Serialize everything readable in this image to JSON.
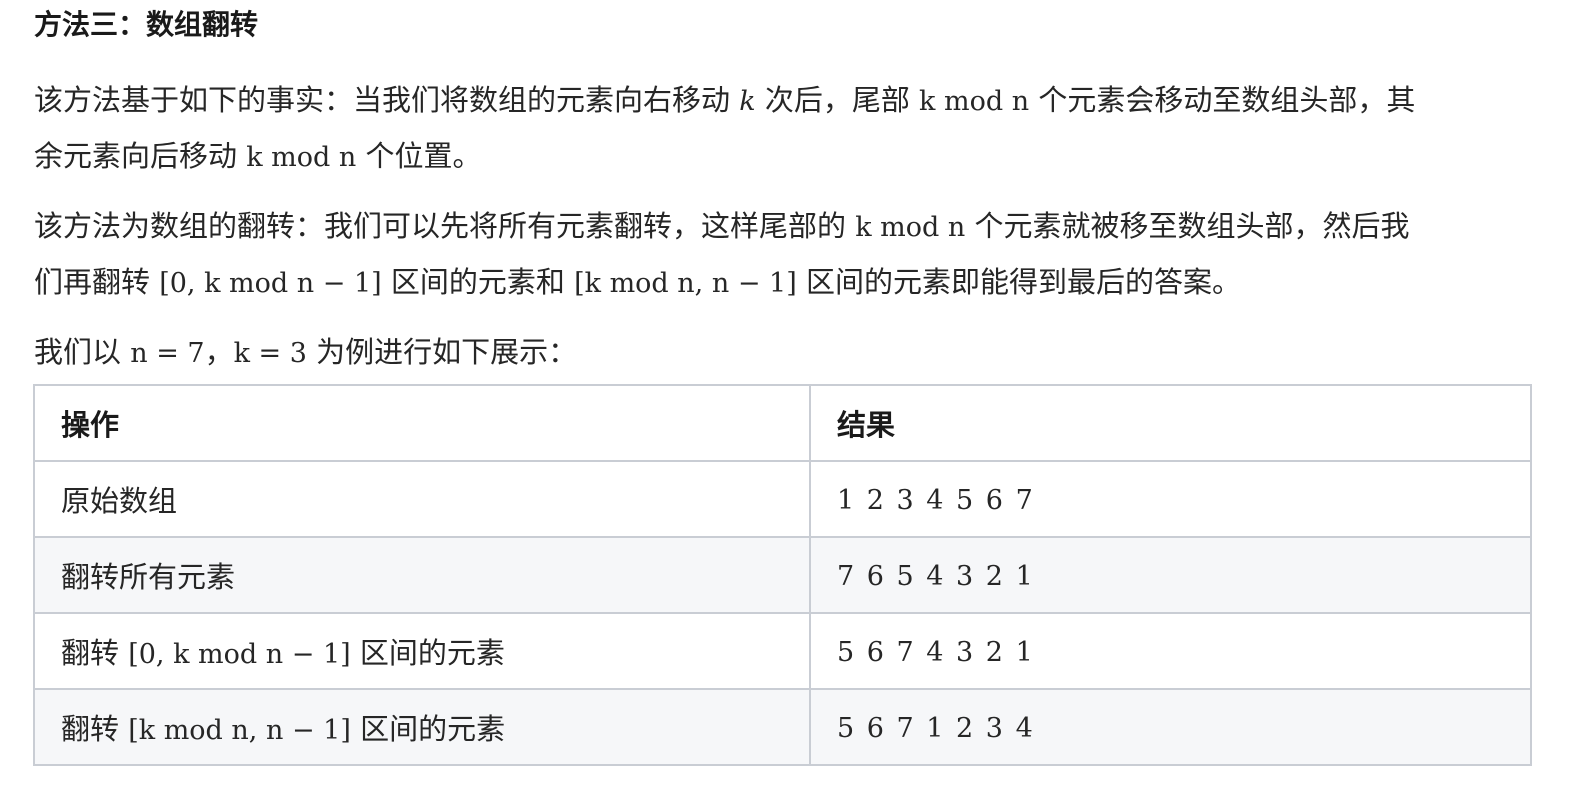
{
  "heading": "方法三：数组翻转",
  "paragraphs": {
    "p1": {
      "line1_a": "该方法基于如下的事实：当我们将数组的元素向右移动 ",
      "k": "k",
      "line1_b": " 次后，尾部 ",
      "kmodn_a": "k mod n",
      "line1_c": " 个元素会移动至数组头部，其",
      "line2_a": "余元素向后移动 ",
      "kmodn_b": "k mod n",
      "line2_b": " 个位置。"
    },
    "p2": {
      "line1_a": "该方法为数组的翻转：我们可以先将所有元素翻转，这样尾部的 ",
      "kmodn": "k mod n",
      "line1_b": " 个元素就被移至数组头部，然后我",
      "line2_a": "们再翻转 ",
      "range1": "[0, k mod n − 1]",
      "line2_b": " 区间的元素和 ",
      "range2": "[k mod n, n − 1]",
      "line2_c": " 区间的元素即能得到最后的答案。"
    },
    "p3": {
      "a": "我们以 ",
      "n_eq": "n = 7",
      "b": "，",
      "k_eq": "k = 3",
      "c": " 为例进行如下展示："
    }
  },
  "table": {
    "headers": [
      "操作",
      "结果"
    ],
    "rows": [
      {
        "op_text": "原始数组",
        "op_range": "",
        "op_suffix": "",
        "result": "1 2 3 4 5 6 7"
      },
      {
        "op_text": "翻转所有元素",
        "op_range": "",
        "op_suffix": "",
        "result": "7 6 5 4 3 2 1"
      },
      {
        "op_text": "翻转 ",
        "op_range": "[0, k mod n − 1]",
        "op_suffix": " 区间的元素",
        "result": "5 6 7 4 3 2 1"
      },
      {
        "op_text": "翻转 ",
        "op_range": "[k mod n, n − 1]",
        "op_suffix": " 区间的元素",
        "result": "5 6 7 1 2 3 4"
      }
    ]
  },
  "colors": {
    "text": "#262626",
    "border": "#c9cdd4",
    "row_alt_bg": "#f6f7f9"
  }
}
